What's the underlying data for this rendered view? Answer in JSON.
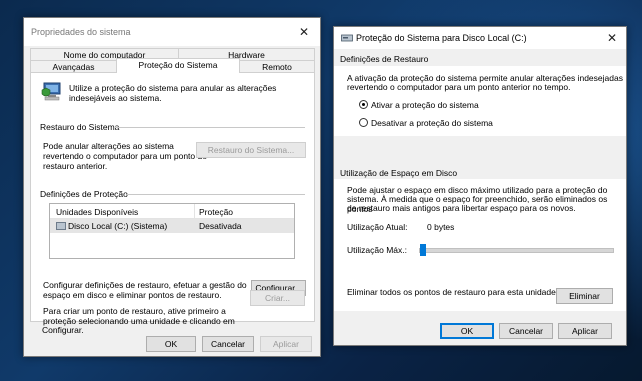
{
  "left_window": {
    "title": "Propriedades do sistema",
    "close_glyph": "✕",
    "tabs_row1": [
      "Nome do computador",
      "Hardware"
    ],
    "tabs_row2": [
      "Avançadas",
      "Proteção do Sistema",
      "Remoto"
    ],
    "intro_text_1": "Utilize a proteção do sistema para anular as alterações",
    "intro_text_2": "indesejáveis ao sistema.",
    "restore_section_title": "Restauro do Sistema",
    "restore_text_1": "Pode anular alterações ao sistema",
    "restore_text_2": "revertendo o computador para um ponto de",
    "restore_text_3": "restauro anterior.",
    "restore_button": "Restauro do Sistema...",
    "protection_section_title": "Definições de Proteção",
    "table_headers": [
      "Unidades Disponíveis",
      "Proteção"
    ],
    "table_rows": [
      {
        "drive": "Disco Local (C:) (Sistema)",
        "protection": "Desativada"
      }
    ],
    "configure_text_1": "Configurar definições de restauro, efetuar a gestão do",
    "configure_text_2": "espaço em disco e eliminar pontos de restauro.",
    "configure_button": "Configurar...",
    "create_text_1": "Para criar um ponto de restauro, ative primeiro a",
    "create_text_2": "proteção selecionando uma unidade e clicando em",
    "create_text_3": "Configurar.",
    "create_button": "Criar...",
    "ok_button": "OK",
    "cancel_button": "Cancelar",
    "apply_button": "Aplicar"
  },
  "right_window": {
    "title": "Proteção do Sistema para Disco Local (C:)",
    "close_glyph": "✕",
    "restore_settings_title": "Definições de Restauro",
    "restore_settings_text_1": "A ativação da proteção do sistema permite anular alterações indesejadas",
    "restore_settings_text_2": "revertendo o computador para um ponto anterior no tempo.",
    "radio_enable": "Ativar a proteção do sistema",
    "radio_disable": "Desativar a proteção do sistema",
    "radio_selected": "enable",
    "disk_usage_title": "Utilização de Espaço em Disco",
    "disk_text_1": "Pode ajustar o espaço em disco máximo utilizado para a proteção do",
    "disk_text_2": "sistema. À medida que o espaço for preenchido, serão eliminados os pontos",
    "disk_text_3": "de restauro mais antigos para libertar espaço para os novos.",
    "current_usage_label": "Utilização Atual:",
    "current_usage_value": "0 bytes",
    "max_usage_label": "Utilização Máx.:",
    "max_usage_fraction": 0.0,
    "delete_text": "Eliminar todos os pontos de restauro para esta unidade.",
    "delete_button": "Eliminar",
    "ok_button": "OK",
    "cancel_button": "Cancelar",
    "apply_button": "Aplicar"
  }
}
